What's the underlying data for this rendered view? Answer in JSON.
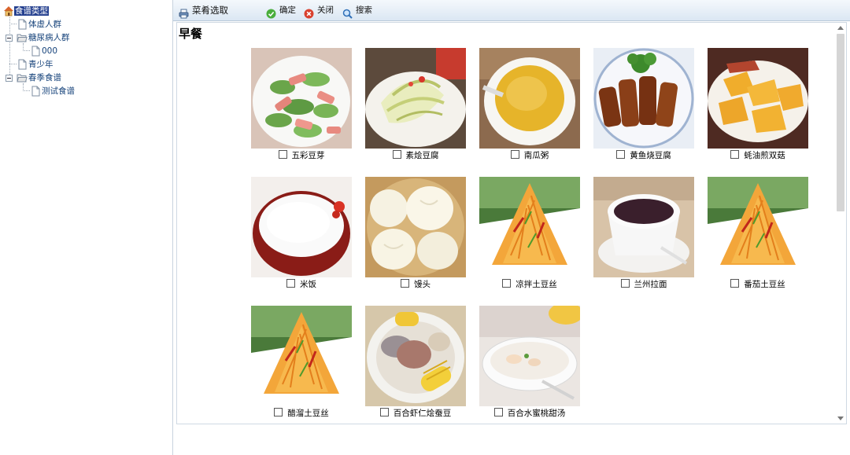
{
  "tree": {
    "root": "食谱类型",
    "items": [
      {
        "label": "体虚人群"
      },
      {
        "label": "糖尿病人群"
      },
      {
        "label": "000"
      },
      {
        "label": "青少年"
      },
      {
        "label": "春季食谱"
      },
      {
        "label": "测试食谱"
      }
    ]
  },
  "toolbar": {
    "title": "菜肴选取",
    "confirm": "确定",
    "close": "关闭",
    "search": "搜索"
  },
  "content": {
    "section_title": "早餐",
    "dishes": [
      {
        "name": "五彩豆芽",
        "checked": false,
        "image": "cucumber-ham-salad"
      },
      {
        "name": "素烩豆腐",
        "checked": false,
        "image": "cabbage-dish"
      },
      {
        "name": "南瓜粥",
        "checked": false,
        "image": "pumpkin-porridge"
      },
      {
        "name": "黄鱼烧豆腐",
        "checked": false,
        "image": "braised-fish"
      },
      {
        "name": "蚝油煎双菇",
        "checked": false,
        "image": "sweet-potato-slices"
      },
      {
        "name": "米饭",
        "checked": false,
        "image": "rice-bowl"
      },
      {
        "name": "馒头",
        "checked": false,
        "image": "steamed-buns"
      },
      {
        "name": "凉拌土豆丝",
        "checked": false,
        "image": "potato-shreds"
      },
      {
        "name": "兰州拉面",
        "checked": false,
        "image": "dark-soup-cup"
      },
      {
        "name": "番茄土豆丝",
        "checked": false,
        "image": "potato-shreds"
      },
      {
        "name": "醋溜土豆丝",
        "checked": false,
        "image": "potato-shreds"
      },
      {
        "name": "百合虾仁烩蚕豆",
        "checked": false,
        "image": "corn-pork-soup"
      },
      {
        "name": "百合水蜜桃甜汤",
        "checked": false,
        "image": "white-soup"
      }
    ]
  },
  "colors": {
    "tree_text": "#15427a",
    "tree_selected_bg": "#25408f",
    "toolbar_bg": "#dbe7f3"
  }
}
